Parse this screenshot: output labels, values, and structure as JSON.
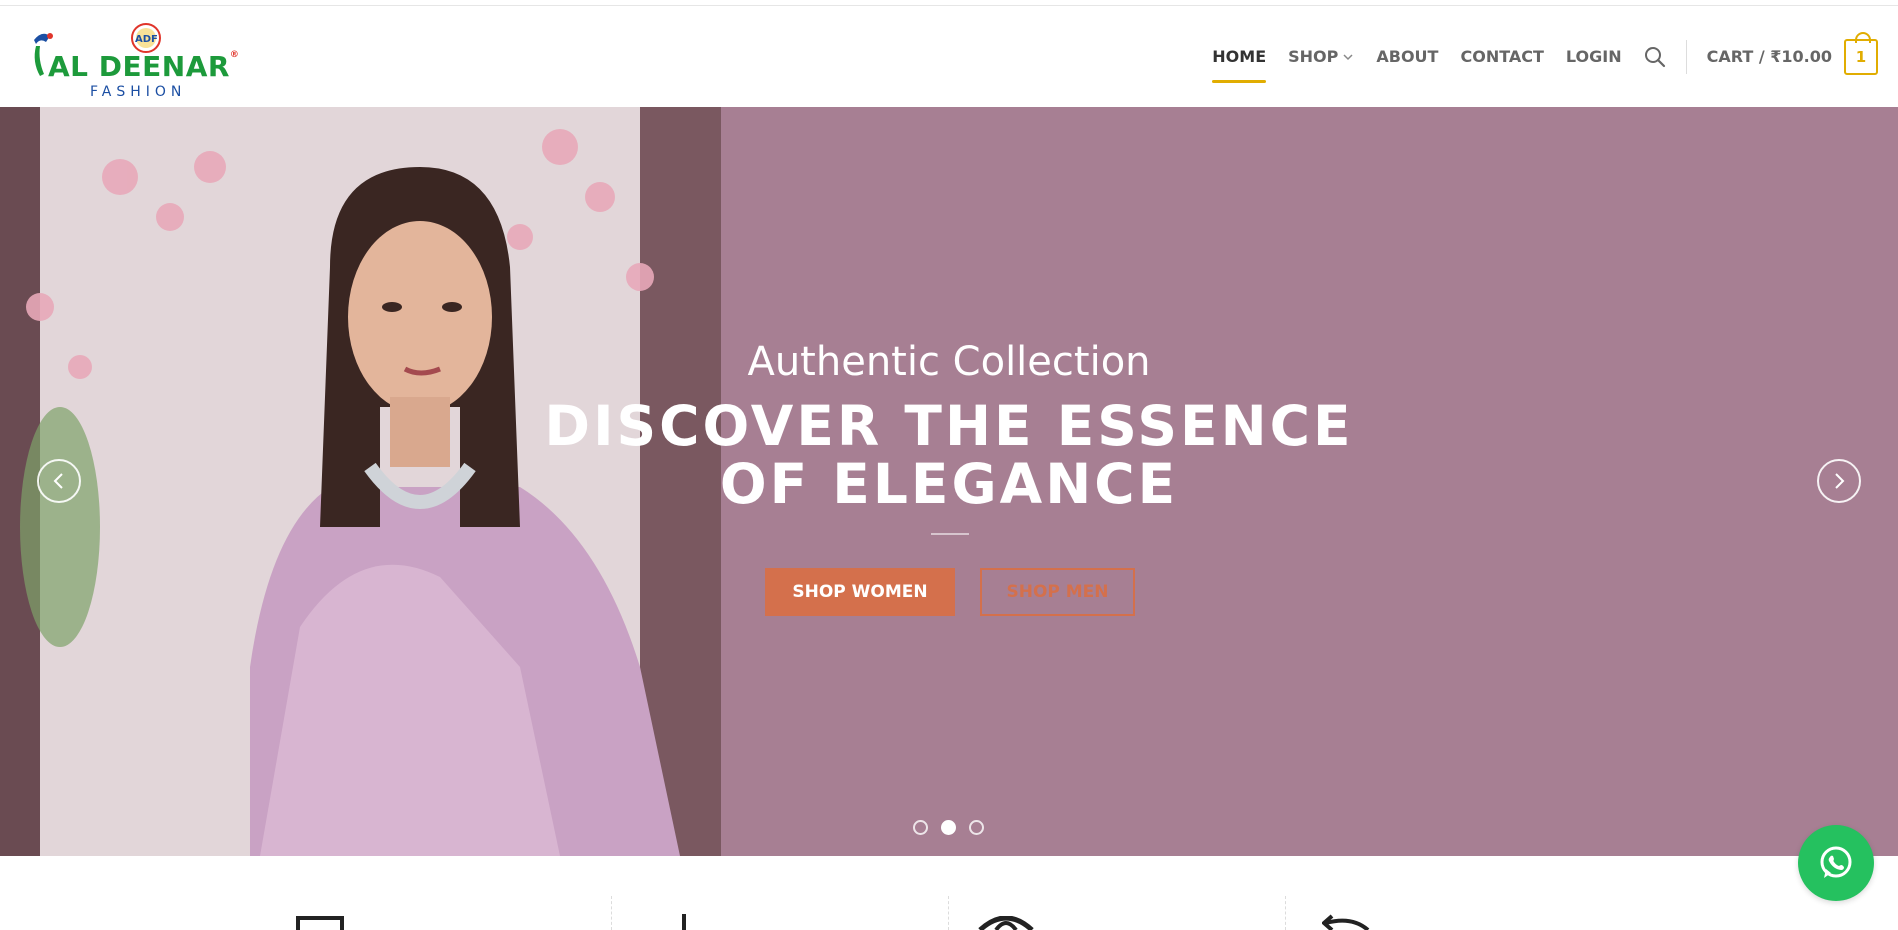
{
  "brand": {
    "name": "AL DEENAR",
    "tagline": "FASHION",
    "mark": "ADF",
    "colors": {
      "green": "#1d9a3b",
      "blue": "#1c4fa3",
      "red": "#e0352b"
    }
  },
  "nav": {
    "items": [
      {
        "label": "HOME",
        "active": true
      },
      {
        "label": "SHOP",
        "has_dropdown": true
      },
      {
        "label": "ABOUT"
      },
      {
        "label": "CONTACT"
      },
      {
        "label": "LOGIN"
      }
    ],
    "search_icon": "search-icon",
    "cart": {
      "label": "CART / ₹10.00",
      "count": "1"
    },
    "accent_color": "#e1ad01"
  },
  "hero": {
    "eyebrow": "Authentic Collection",
    "headline_line1": "DISCOVER THE ESSENCE",
    "headline_line2": "OF ELEGANCE",
    "buttons": {
      "primary": "SHOP WOMEN",
      "secondary": "SHOP MEN"
    },
    "background_color": "#a77f93",
    "button_color": "#d4704c",
    "slides": 3,
    "active_slide": 2
  },
  "features": {
    "icons": [
      "envelope-icon",
      "tool-icon",
      "globe-icon",
      "return-arrow-icon"
    ]
  },
  "whatsapp": {
    "icon": "whatsapp-icon",
    "color": "#25c15f"
  }
}
